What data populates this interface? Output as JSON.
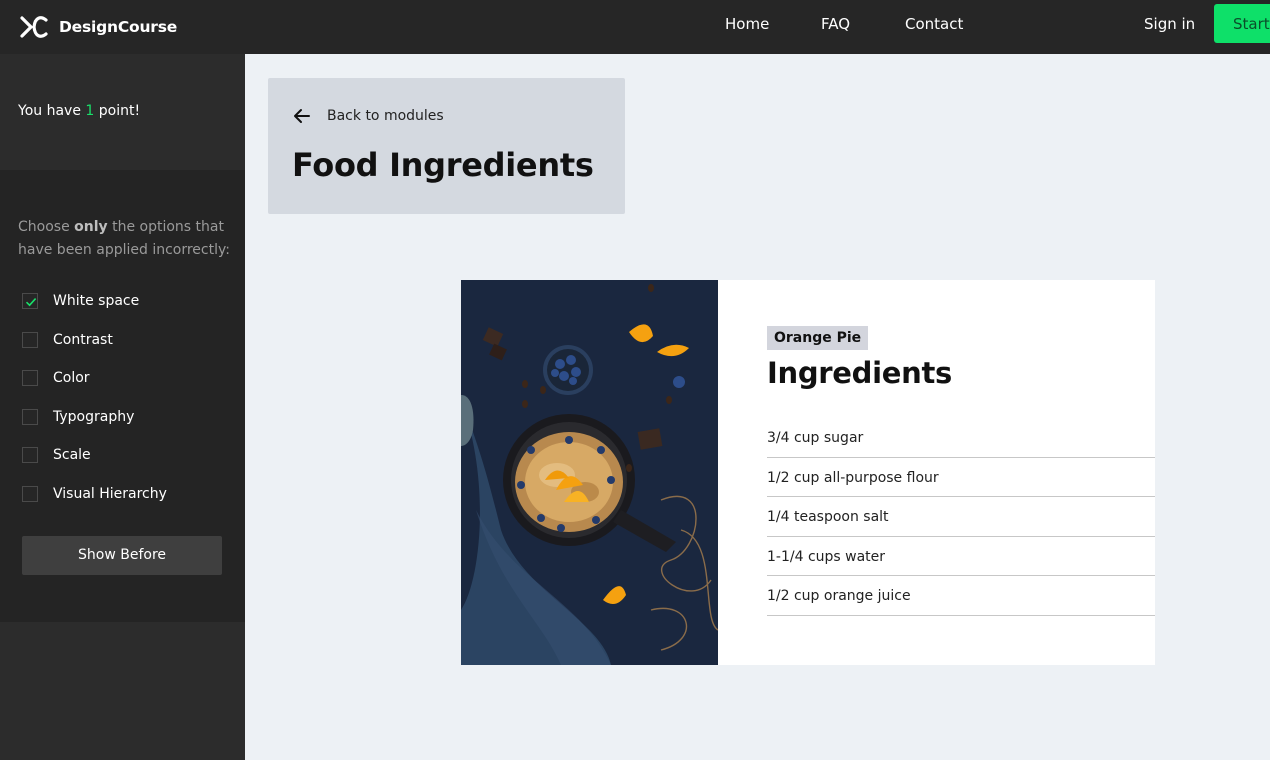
{
  "header": {
    "brand": "DesignCourse",
    "nav": {
      "home": "Home",
      "faq": "FAQ",
      "contact": "Contact",
      "sign_in": "Sign in",
      "start": "Start"
    }
  },
  "sidebar": {
    "points": {
      "prefix": "You have",
      "value": "1",
      "suffix": "point!"
    },
    "instructions": {
      "before": "Choose",
      "emphasis": "only",
      "after": "the options that have been applied incorrectly:"
    },
    "options": [
      {
        "label": "White space",
        "checked": true
      },
      {
        "label": "Contrast",
        "checked": false
      },
      {
        "label": "Color",
        "checked": false
      },
      {
        "label": "Typography",
        "checked": false
      },
      {
        "label": "Scale",
        "checked": false
      },
      {
        "label": "Visual Hierarchy",
        "checked": false
      }
    ],
    "show_before_label": "Show Before"
  },
  "module": {
    "back_label": "Back to modules",
    "title": "Food Ingredients"
  },
  "recipe": {
    "tag": "Orange Pie",
    "heading": "Ingredients",
    "ingredients": [
      "3/4 cup sugar",
      "1/2 cup all-purpose flour",
      "1/4 teaspoon salt",
      "1-1/4 cups water",
      "1/2 cup orange juice"
    ]
  },
  "colors": {
    "accent_green": "#0ee069",
    "topbar": "#262626",
    "sidebar": "#2c2c2c",
    "page_bg": "#edf1f5"
  }
}
